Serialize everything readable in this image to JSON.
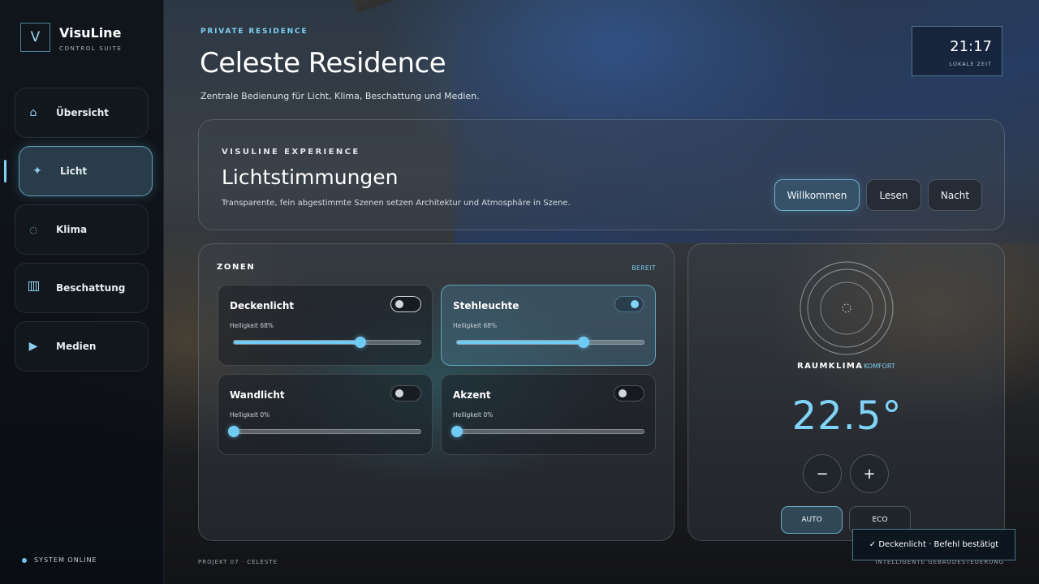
{
  "brand": {
    "logo_letter": "V",
    "name": "VisuLine",
    "subtitle": "CONTROL SUITE"
  },
  "sidebar": {
    "items": [
      {
        "label": "Übersicht",
        "icon": "home-icon",
        "active": false
      },
      {
        "label": "Licht",
        "icon": "sparkle-icon",
        "active": true
      },
      {
        "label": "Klima",
        "icon": "climate-icon",
        "active": false
      },
      {
        "label": "Beschattung",
        "icon": "blinds-icon",
        "active": false
      },
      {
        "label": "Medien",
        "icon": "play-icon",
        "active": false
      }
    ],
    "status": "SYSTEM ONLINE"
  },
  "header": {
    "eyebrow": "PRIVATE RESIDENCE",
    "title": "Celeste Residence",
    "subtitle": "Zentrale Bedienung für Licht, Klima, Beschattung und Medien."
  },
  "clock": {
    "time": "21:17",
    "label": "LOKALE ZEIT"
  },
  "scenes": {
    "eyebrow": "VISULINE EXPERIENCE",
    "title": "Lichtstimmungen",
    "description": "Transparente, fein abgestimmte Szenen setzen Architektur und Atmosphäre in Szene.",
    "buttons": [
      {
        "label": "Willkommen",
        "active": true
      },
      {
        "label": "Lesen",
        "active": false
      },
      {
        "label": "Nacht",
        "active": false
      }
    ]
  },
  "zones": {
    "title": "ZONEN",
    "status": "BEREIT",
    "items": [
      {
        "name": "Deckenlicht",
        "brightness_label": "Helligkeit 68%",
        "brightness": 68,
        "on": false
      },
      {
        "name": "Stehleuchte",
        "brightness_label": "Helligkeit 68%",
        "brightness": 68,
        "on": true
      },
      {
        "name": "Wandlicht",
        "brightness_label": "Helligkeit 0%",
        "brightness": 0,
        "on": false
      },
      {
        "name": "Akzent",
        "brightness_label": "Helligkeit 0%",
        "brightness": 0,
        "on": false
      }
    ]
  },
  "climate": {
    "label": "RAUMKLIMA",
    "mode_label": "KOMFORT",
    "temperature": "22.5°",
    "decrease": "−",
    "increase": "+",
    "modes": [
      {
        "label": "AUTO",
        "active": true
      },
      {
        "label": "ECO",
        "active": false
      }
    ]
  },
  "footer": {
    "left": "PROJEKT 07 · CELESTE",
    "right": "INTELLIGENTE GEBÄUDESTEUERUNG"
  },
  "toast": {
    "text": "✓ Deckenlicht · Befehl bestätigt"
  },
  "colors": {
    "accent": "#7fd1f5",
    "slider": "#6fcbf3"
  }
}
